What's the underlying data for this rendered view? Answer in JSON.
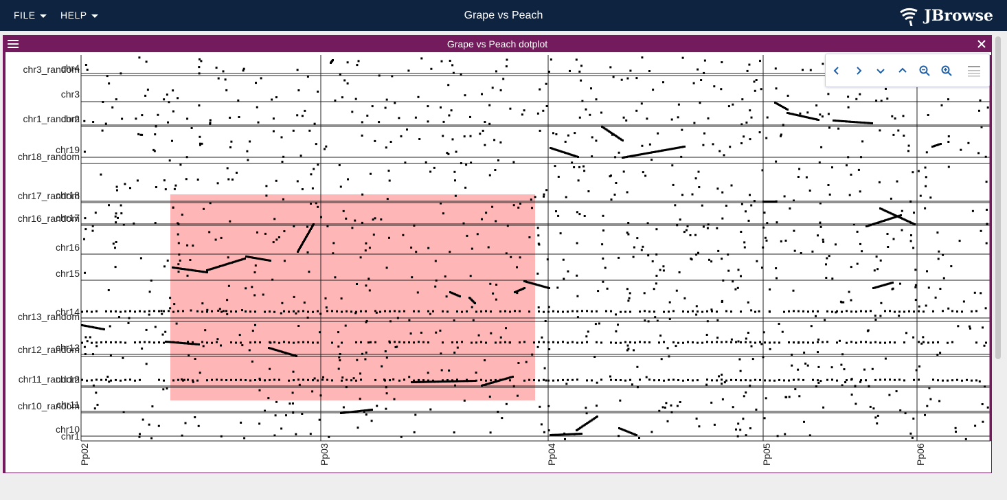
{
  "menu": {
    "file_label": "FILE",
    "help_label": "HELP"
  },
  "app": {
    "title": "Grape vs Peach",
    "logo_text": "JBrowse"
  },
  "view": {
    "title": "Grape vs Peach dotplot"
  },
  "colors": {
    "topbar": "#0d233f",
    "view_header": "#741b5e",
    "selection": "#ff9e9e",
    "toolbar_icon": "#1e5fa8"
  },
  "toolbar": {
    "icons": [
      "chevron-left-icon",
      "chevron-right-icon",
      "chevron-down-icon",
      "chevron-up-icon",
      "zoom-out-icon",
      "zoom-in-icon",
      "settings-menu-icon"
    ]
  },
  "chart_data": {
    "type": "scatter",
    "x_axis_label": "",
    "y_axis_label": "",
    "x_genome": "Peach",
    "y_genome": "Grape",
    "x_ticks": [
      "Pp02",
      "Pp03",
      "Pp04",
      "Pp05",
      "Pp06"
    ],
    "y_ticks": [
      "chr3_random",
      "chr4",
      "chr3",
      "chr1_random",
      "chr2",
      "chr19",
      "chr18_random",
      "chr17_random",
      "chr18",
      "chr16_random",
      "chr17",
      "chr16",
      "chr15",
      "chr14",
      "chr13_random",
      "chr12_random",
      "chr13",
      "chr11_random",
      "chr12",
      "chr10_random",
      "chr11",
      "chr10",
      "chr1"
    ],
    "selection_box": {
      "x_start_region": "Pp02",
      "x_end_region": "Pp03",
      "y_start_region": "chr18",
      "y_end_region": "chr11"
    },
    "grid": true
  }
}
